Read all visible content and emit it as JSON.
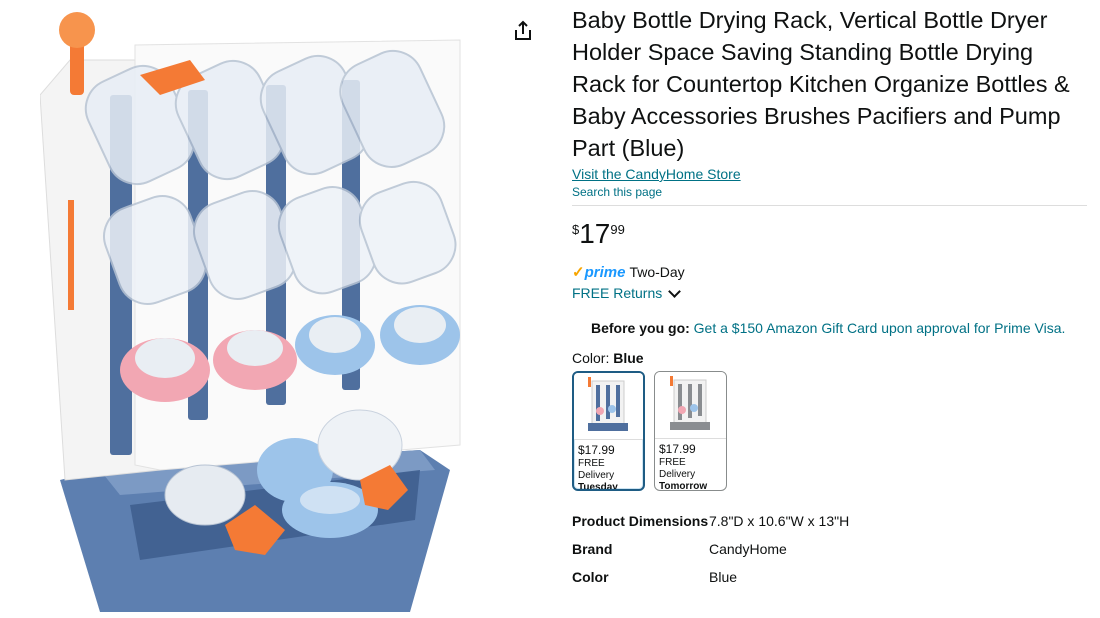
{
  "product": {
    "title": "Baby Bottle Drying Rack, Vertical Bottle Dryer Holder Space Saving Standing Bottle Drying Rack for Countertop Kitchen Organize Bottles & Baby Accessories Brushes Pacifiers and Pump Part (Blue)",
    "store_link": "Visit the CandyHome Store",
    "search_page": "Search this page"
  },
  "price": {
    "symbol": "$",
    "whole": "17",
    "fraction": "99"
  },
  "delivery": {
    "prime_check": "✓",
    "prime_label": "prime",
    "prime_speed": "Two-Day",
    "returns": "FREE Returns"
  },
  "promo": {
    "lead": "Before you go:",
    "offer": "Get a $150 Amazon Gift Card upon approval for Prime Visa."
  },
  "color": {
    "label": "Color:",
    "selected": "Blue",
    "options": [
      {
        "price": "$17.99",
        "delivery": "FREE Delivery",
        "day": "Tuesday",
        "tone": "#4f6f9e"
      },
      {
        "price": "$17.99",
        "delivery": "FREE Delivery",
        "day": "Tomorrow",
        "tone": "#8a8d91"
      }
    ]
  },
  "specs": [
    {
      "key": "Product Dimensions",
      "value": "7.8\"D x 10.6\"W x 13\"H"
    },
    {
      "key": "Brand",
      "value": "CandyHome"
    },
    {
      "key": "Color",
      "value": "Blue"
    }
  ],
  "colors": {
    "link": "#007185",
    "prime": "#1a98ff",
    "prime_check": "#f7a500",
    "rack_blue": "#4f6f9e",
    "pink": "#f2a7b3",
    "light_blue": "#9dc4ea",
    "orange": "#f47a35"
  }
}
